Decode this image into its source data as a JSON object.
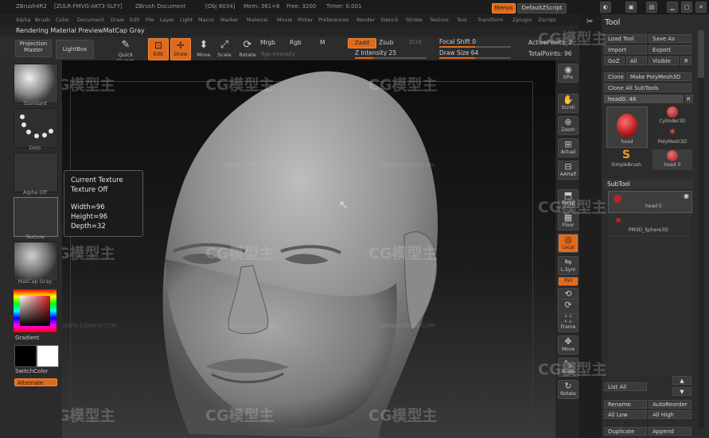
{
  "title_bar": {
    "app": "ZBrush4R2",
    "license": "[ZULR-FMVG-AKT3-SLFY]",
    "document": "ZBrush Document",
    "objects": "[Obj 8034]",
    "mem": "Mem: 361+6",
    "free": "Free: 3200",
    "timer": "Timer: 0.001",
    "menus_button": "Menus",
    "script_button": "DefaultZScript"
  },
  "menu_bar": [
    "Alpha",
    "Brush",
    "Color",
    "Document",
    "Draw",
    "Edit",
    "File",
    "Layer",
    "Light",
    "Macro",
    "Marker",
    "Material",
    "Movie",
    "Picker",
    "Preferences",
    "Render",
    "Stencil",
    "Stroke",
    "Texture",
    "Tool",
    "Transform",
    "Zplugin",
    "Zscript"
  ],
  "status_line": "Rendering Material PreviewMatCap Gray",
  "shelf": {
    "projection_master": "Projection Master",
    "lightbox": "LightBox",
    "quick_sketch": "Quick Sketch",
    "edit": "Edit",
    "draw": "Draw",
    "move": "Move",
    "scale": "Scale",
    "rotate": "Rotate",
    "mrgb": "Mrgb",
    "rgb": "Rgb",
    "m": "M",
    "rgb_intensity": "Rgb Intensity",
    "zadd": "Zadd",
    "zsub": "Zsub",
    "zcut": "Zcut",
    "z_intensity": "Z Intensity 25",
    "focal_shift": "Focal Shift 0",
    "draw_size": "Draw Size 64",
    "active_points": "ActivePoints: 2",
    "total_points": "TotalPoints: 96"
  },
  "left_shelf": {
    "standard": "Standard",
    "dots": "Dots",
    "alpha_off": "Alpha Off",
    "texture": "Texture",
    "matcap": "MatCap Gray",
    "gradient": "Gradient",
    "switch_color": "SwitchColor",
    "alternate": "Alternate"
  },
  "tooltip": {
    "line1": "Current Texture",
    "line2": "Texture Off",
    "width": "Width=96",
    "height": "Height=96",
    "depth": "Depth=32"
  },
  "right_shelf": [
    "SPix",
    "Scroll",
    "Zoom",
    "Actual",
    "AAHalf",
    "Persp",
    "Floor",
    "Local",
    "L.Sym",
    "Xyz",
    "",
    "",
    "Frame",
    "Move",
    "Scale",
    "Rotate"
  ],
  "tool_panel": {
    "title": "Tool",
    "load_tool": "Load Tool",
    "save_as": "Save As",
    "import": "Import",
    "export": "Export",
    "goz": "GoZ",
    "all": "All",
    "visible": "Visible",
    "r": "R",
    "clone": "Clone",
    "make_polymesh": "Make PolyMesh3D",
    "clone_all_subtools": "Clone All SubTools",
    "head_slider": "head0. 48",
    "head_label": "head",
    "cylinder": "Cylinder3D",
    "polymesh": "PolyMesh3D",
    "simplebrush": "SimpleBrush",
    "head0": "head 0",
    "subtool": "SubTool",
    "subtool_item1": "head 0",
    "subtool_item2": "PM3D_Sphere3D",
    "list_all": "List All",
    "rename": "Rename",
    "autoreorder": "AutoReorder",
    "all_low": "All Low",
    "all_high": "All High",
    "duplicate": "Duplicate",
    "append": "Append"
  },
  "watermark": {
    "logo": "CG模型主",
    "url": "WWW.CGMXW.COM"
  },
  "colors": {
    "accent_orange": "#e06a1c",
    "panel_bg": "#2c2c2c",
    "viewport_bg": "#111111"
  }
}
